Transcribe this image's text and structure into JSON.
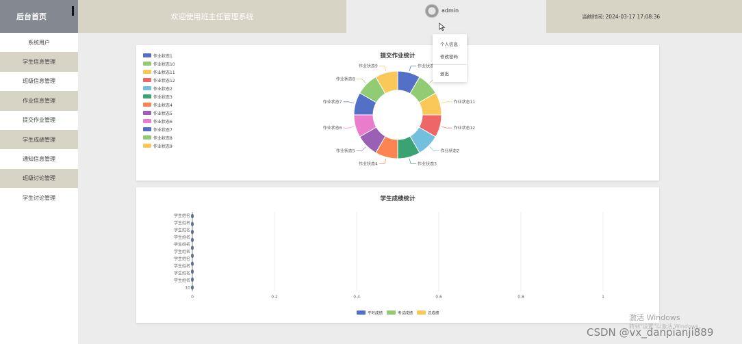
{
  "header": {
    "home_label": "后台首页",
    "welcome": "欢迎使用班主任管理系统",
    "username": "admin",
    "time_label": "当前时间:",
    "time_value": "2024-03-17 17:08:36"
  },
  "dropdown": {
    "items": [
      "个人信息",
      "修改密码",
      "退出"
    ]
  },
  "sidebar": {
    "items": [
      {
        "label": "系统用户",
        "alt": false
      },
      {
        "label": "学生信息管理",
        "alt": true
      },
      {
        "label": "班级信息管理",
        "alt": false
      },
      {
        "label": "作业信息管理",
        "alt": true
      },
      {
        "label": "提交作业管理",
        "alt": false
      },
      {
        "label": "学生成绩管理",
        "alt": true
      },
      {
        "label": "通知信息管理",
        "alt": false
      },
      {
        "label": "班级讨论管理",
        "alt": true
      },
      {
        "label": "学生讨论管理",
        "alt": false
      }
    ]
  },
  "chart_data": [
    {
      "type": "pie",
      "donut": true,
      "title": "提交作业统计",
      "legend_position": "top-left",
      "labels": [
        "作业状态1",
        "作业状态10",
        "作业状态11",
        "作业状态12",
        "作业状态2",
        "作业状态3",
        "作业状态4",
        "作业状态5",
        "作业状态6",
        "作业状态7",
        "作业状态8",
        "作业状态9"
      ],
      "values": [
        1,
        1,
        1,
        1,
        1,
        1,
        1,
        1,
        1,
        1,
        1,
        1
      ],
      "colors": [
        "#5470c6",
        "#91cc75",
        "#fac858",
        "#ee6666",
        "#73c0de",
        "#3ba272",
        "#fc8452",
        "#9a60b4",
        "#ea7ccc",
        "#5470c6",
        "#91cc75",
        "#fac858"
      ]
    },
    {
      "type": "bar",
      "orientation": "horizontal",
      "title": "学生成绩统计",
      "legend_position": "bottom",
      "categories": [
        "学生姓名1",
        "学生姓名2",
        "学生姓名3",
        "学生姓名4",
        "学生姓名5",
        "学生姓名6",
        "学生姓名7",
        "学生姓名8",
        "学生姓名9",
        "学生姓名10"
      ],
      "category_tick_labels": [
        "学生姓名",
        "学生姓名",
        "学生姓名",
        "学生姓名",
        "学生姓名",
        "学生姓名",
        "学生姓名",
        "学生姓名",
        "学生姓名",
        "学生姓名",
        "10"
      ],
      "x_ticks": [
        "0",
        "0.2",
        "0.4",
        "0.6",
        "0.8",
        "1"
      ],
      "xlim": [
        0,
        1
      ],
      "grid": true,
      "series": [
        {
          "name": "平时成绩",
          "color": "#5470c6",
          "values": [
            0,
            0,
            0,
            0,
            0,
            0,
            0,
            0,
            0,
            0
          ]
        },
        {
          "name": "考试成绩",
          "color": "#91cc75",
          "values": [
            0,
            0,
            0,
            0,
            0,
            0,
            0,
            0,
            0,
            0
          ]
        },
        {
          "name": "总成绩",
          "color": "#fac858",
          "values": [
            0,
            0,
            0,
            0,
            0,
            0,
            0,
            0,
            0,
            0
          ]
        }
      ]
    }
  ],
  "watermark": {
    "line1": "激活 Windows",
    "line2": "转到\"设置\"以激活 Windows。",
    "csdn": "CSDN @vx_danpianji889"
  }
}
